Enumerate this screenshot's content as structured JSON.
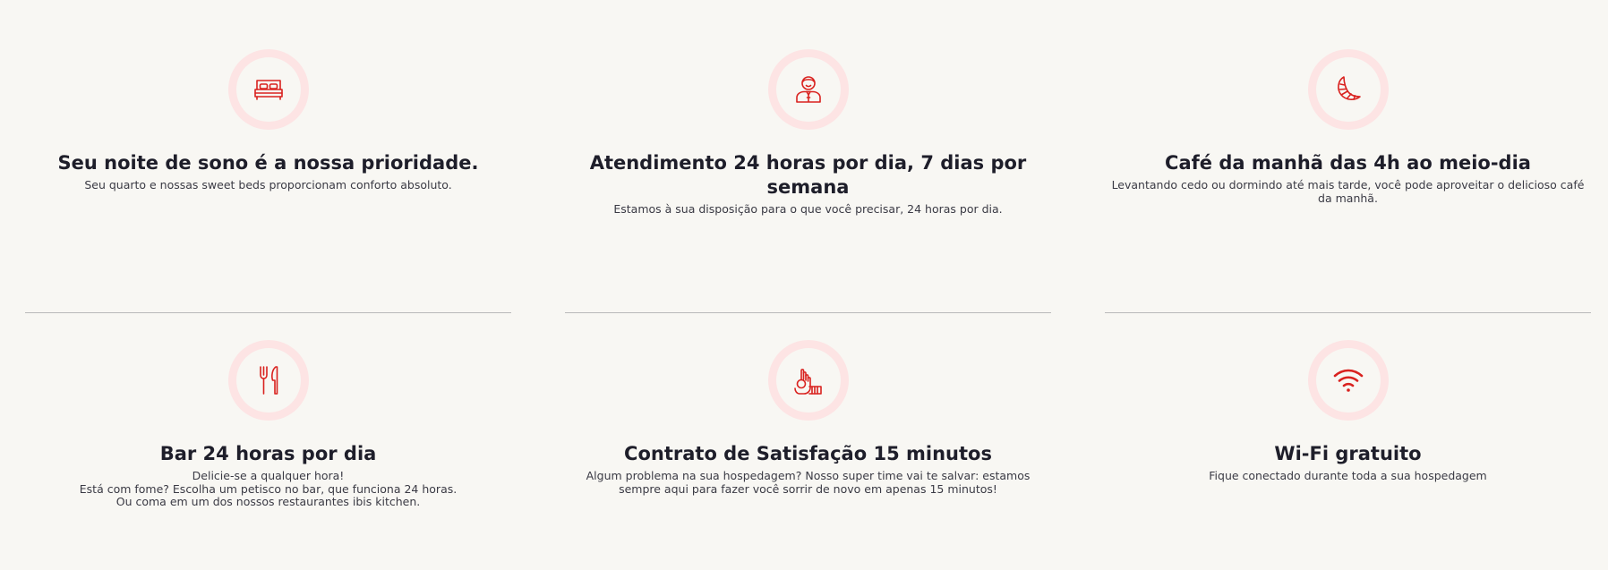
{
  "colors": {
    "background": "#f8f7f3",
    "accent": "#d9221f",
    "icon_ring": "#fde4e4",
    "title": "#1e1e2a",
    "divider": "#b9b9b9"
  },
  "features": [
    {
      "icon": "bed-icon",
      "title": "Seu noite de sono é a nossa prioridade.",
      "description": "Seu quarto e nossas sweet beds proporcionam conforto absoluto."
    },
    {
      "icon": "receptionist-icon",
      "title": "Atendimento 24 horas por dia, 7 dias por semana",
      "description": "Estamos à sua disposição para o que você precisar, 24 horas por dia."
    },
    {
      "icon": "croissant-icon",
      "title": "Café da manhã das 4h ao meio-dia",
      "description": "Levantando cedo ou dormindo até mais tarde, você pode aproveitar o delicioso café da manhã."
    },
    {
      "icon": "fork-knife-icon",
      "title": "Bar 24 horas por dia",
      "description": "Delicie-se a qualquer hora!\nEstá com fome? Escolha um petisco no bar, que funciona 24 horas.\nOu coma em um dos nossos restaurantes ibis kitchen."
    },
    {
      "icon": "ok-hand-icon",
      "title": "Contrato de Satisfação 15 minutos",
      "description": "Algum problema na sua hospedagem? Nosso super time vai te salvar: estamos sempre aqui para fazer você sorrir de novo em apenas 15 minutos!"
    },
    {
      "icon": "wifi-icon",
      "title": "Wi-Fi gratuito",
      "description": "Fique conectado durante toda a sua hospedagem"
    }
  ]
}
